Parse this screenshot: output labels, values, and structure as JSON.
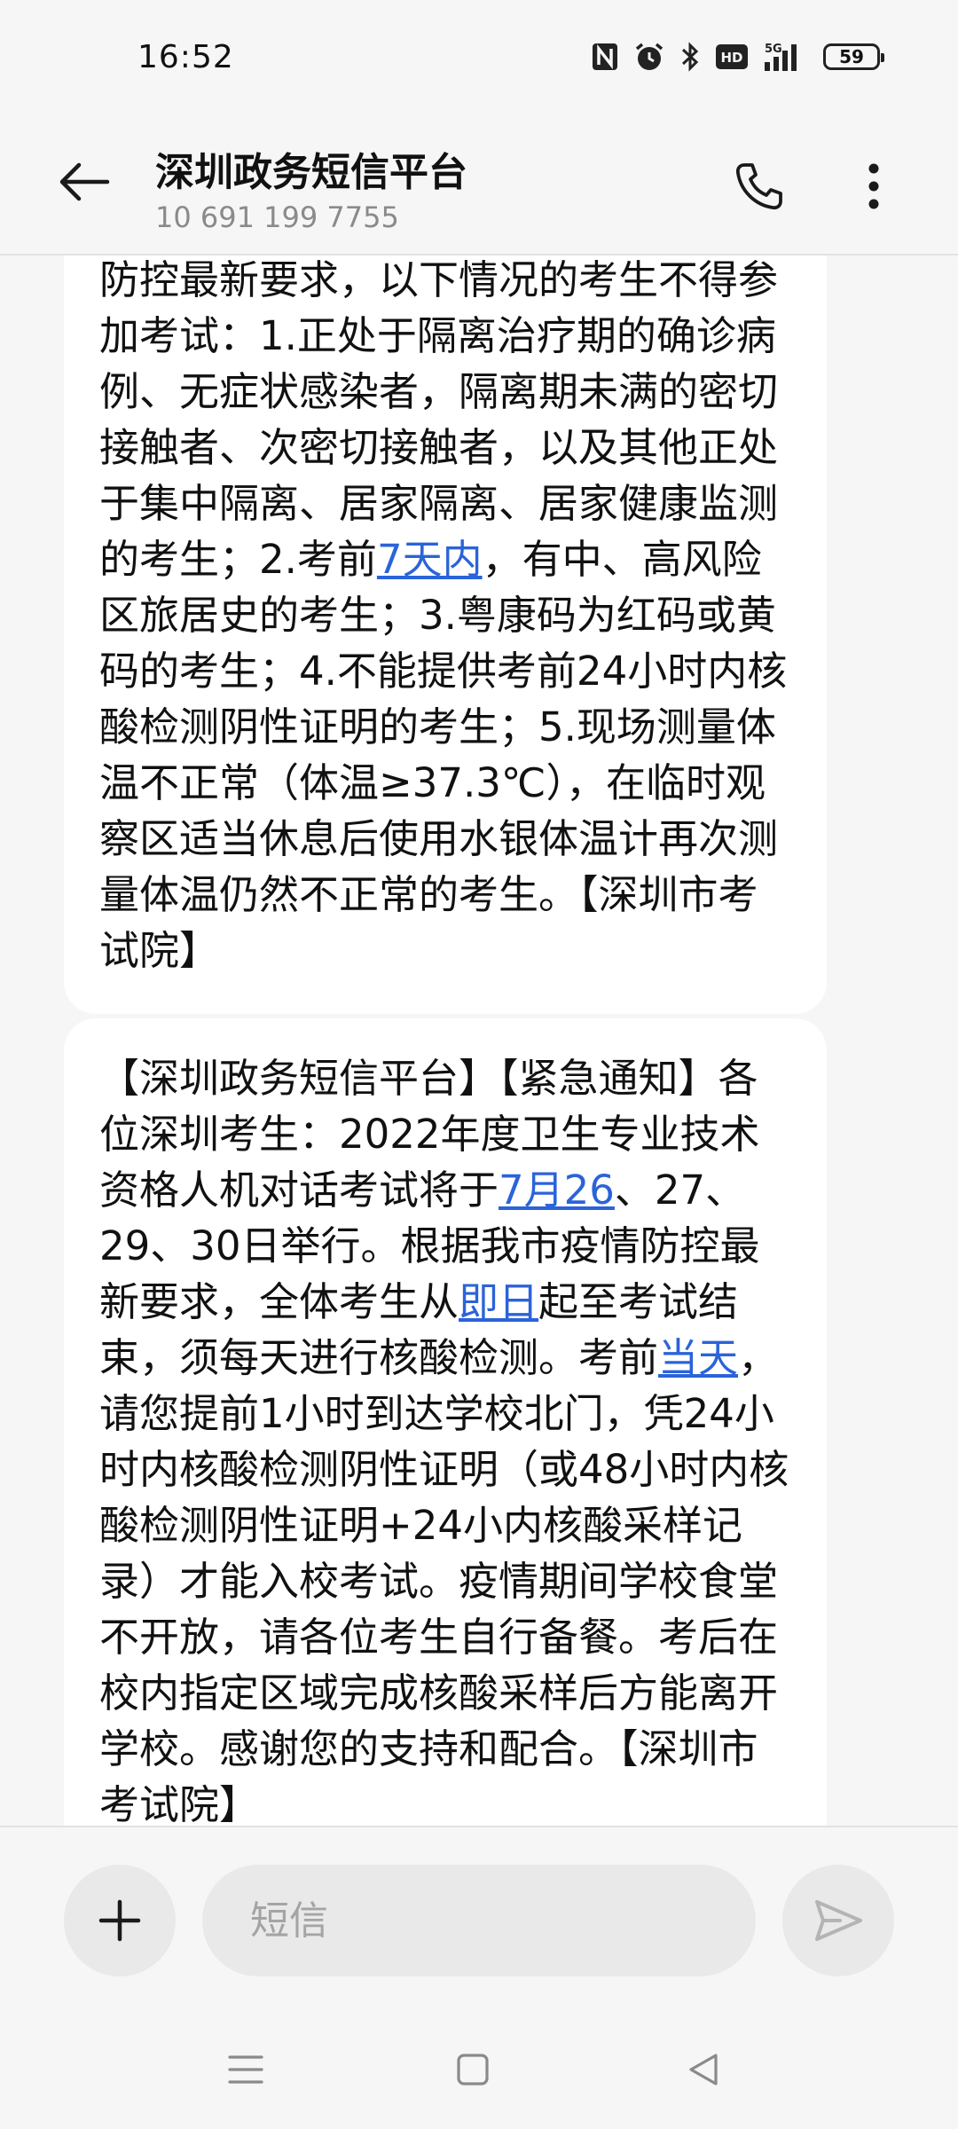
{
  "status_bar": {
    "time": "16:52",
    "network": "5G",
    "hd": "HD",
    "battery": "59",
    "icons": [
      "nfc-icon",
      "alarm-icon",
      "bluetooth-icon",
      "hd-icon",
      "signal-5g-icon",
      "battery-icon"
    ]
  },
  "header": {
    "title": "深圳政务短信平台",
    "number": "10 691 199 7755",
    "icons": [
      "back-arrow-icon",
      "phone-icon",
      "more-vertical-icon"
    ]
  },
  "messages": [
    {
      "parts": [
        {
          "text": "防控最新要求，以下情况的考生不得参加考试：1.正处于隔离治疗期的确诊病例、无症状感染者，隔离期未满的密切接触者、次密切接触者，以及其他正处于集中隔离、居家隔离、居家健康监测的考生；2.考前"
        },
        {
          "text": "7天内",
          "link": true
        },
        {
          "text": "，有中、高风险区旅居史的考生；3.粤康码为红码或黄码的考生；4.不能提供考前24小时内核酸检测阴性证明的考生；5.现场测量体温不正常（体温≥37.3℃），在临时观察区适当休息后使用水银体温计再次测量体温仍然不正常的考生。【深圳市考试院】"
        }
      ]
    },
    {
      "parts": [
        {
          "text": "【深圳政务短信平台】【紧急通知】各位深圳考生：2022年度卫生专业技术资格人机对话考试将于"
        },
        {
          "text": "7月26",
          "link": true
        },
        {
          "text": "、27、29、30日举行。根据我市疫情防控最新要求，全体考生从"
        },
        {
          "text": "即日",
          "link": true
        },
        {
          "text": "起至考试结束，须每天进行核酸检测。考前"
        },
        {
          "text": "当天",
          "link": true
        },
        {
          "text": "，请您提前1小时到达学校北门，凭24小时内核酸检测阴性证明（或48小时内核酸检测阴性证明+24小内核酸采样记录）才能入校考试。疫情期间学校食堂不开放，请各位考生自行备餐。考后在校内指定区域完成核酸采样后方能离开学校。感谢您的支持和配合。【深圳市考试院】"
        }
      ]
    }
  ],
  "composer": {
    "placeholder": "短信",
    "value": "",
    "icons": [
      "plus-icon",
      "send-icon"
    ]
  },
  "nav": {
    "icons": [
      "menu-icon",
      "home-square-icon",
      "back-triangle-icon"
    ]
  }
}
